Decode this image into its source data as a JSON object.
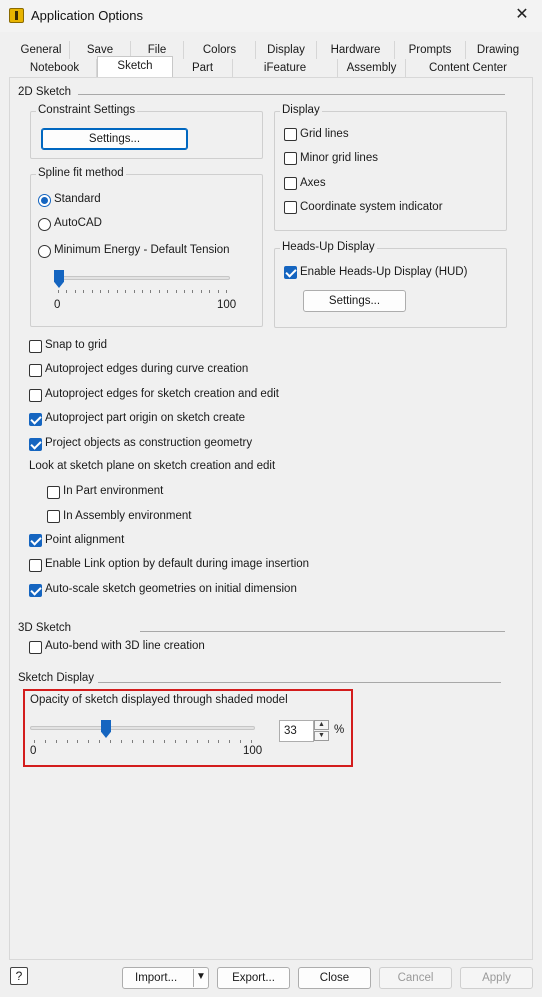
{
  "window": {
    "title": "Application Options"
  },
  "tabs_row1": [
    "General",
    "Save",
    "File",
    "Colors",
    "Display",
    "Hardware",
    "Prompts",
    "Drawing"
  ],
  "tabs_row2": [
    "Notebook",
    "Sketch",
    "Part",
    "iFeature",
    "Assembly",
    "Content Center"
  ],
  "sketch2d": {
    "header": "2D Sketch",
    "constraint": {
      "title": "Constraint Settings",
      "button": "Settings..."
    },
    "spline": {
      "title": "Spline fit method",
      "options": [
        "Standard",
        "AutoCAD",
        "Minimum Energy - Default Tension"
      ],
      "selected": "Standard",
      "tension_min": "0",
      "tension_max": "100",
      "tension_value": 0
    },
    "display": {
      "title": "Display",
      "items": [
        {
          "label": "Grid lines",
          "checked": false
        },
        {
          "label": "Minor grid lines",
          "checked": false
        },
        {
          "label": "Axes",
          "checked": false
        },
        {
          "label": "Coordinate system indicator",
          "checked": false
        }
      ]
    },
    "hud": {
      "title": "Heads-Up Display",
      "enable_label": "Enable Heads-Up Display (HUD)",
      "enabled": true,
      "button": "Settings..."
    },
    "options": [
      {
        "label": "Snap to grid",
        "checked": false
      },
      {
        "label": "Autoproject edges during curve creation",
        "checked": false
      },
      {
        "label": "Autoproject edges for sketch creation and edit",
        "checked": false
      },
      {
        "label": "Autoproject part origin on sketch create",
        "checked": true
      },
      {
        "label": "Project objects as construction geometry",
        "checked": true
      }
    ],
    "look_at": {
      "label": "Look at sketch plane on sketch creation and edit",
      "items": [
        {
          "label": "In Part environment",
          "checked": false
        },
        {
          "label": "In Assembly environment",
          "checked": false
        }
      ]
    },
    "options2": [
      {
        "label": "Point alignment",
        "checked": true
      },
      {
        "label": "Enable Link option by default during image insertion",
        "checked": false
      },
      {
        "label": "Auto-scale sketch geometries on initial dimension",
        "checked": true
      }
    ]
  },
  "sketch3d": {
    "header": "3D Sketch",
    "autobend": {
      "label": "Auto-bend with 3D line creation",
      "checked": false
    }
  },
  "sketch_display": {
    "header": "Sketch Display",
    "opacity_label": "Opacity of sketch displayed through shaded model",
    "min": "0",
    "max": "100",
    "value": "33",
    "unit": "%",
    "fraction": 0.33
  },
  "footer": {
    "import": "Import...",
    "export": "Export...",
    "close": "Close",
    "cancel": "Cancel",
    "apply": "Apply",
    "help_icon": "help-icon"
  }
}
